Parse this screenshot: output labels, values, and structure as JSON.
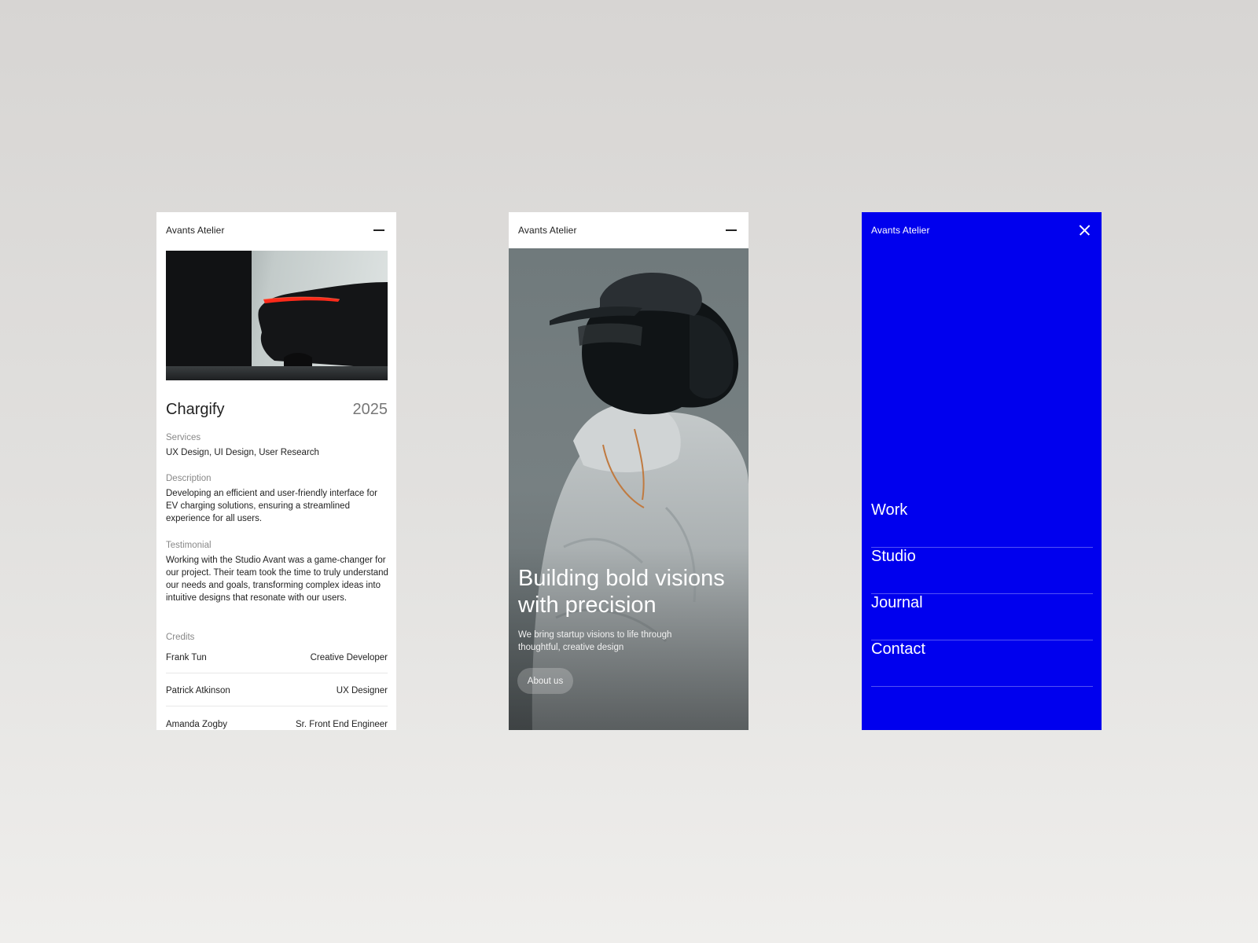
{
  "brand": "Avants Atelier",
  "project_screen": {
    "title": "Chargify",
    "year": "2025",
    "services_label": "Services",
    "services": "UX Design, UI Design, User Research",
    "description_label": "Description",
    "description": "Developing an efficient and user-friendly interface for EV charging solutions, ensuring a streamlined experience for all users.",
    "testimonial_label": "Testimonial",
    "testimonial": "Working with the Studio Avant was a game-changer for our project. Their team took the time to truly understand our needs and goals, transforming complex ideas into intuitive designs that resonate with our users.",
    "credits_label": "Credits",
    "credits": [
      {
        "name": "Frank Tun",
        "role": "Creative Developer"
      },
      {
        "name": "Patrick Atkinson",
        "role": "UX Designer"
      },
      {
        "name": "Amanda Zogby",
        "role": "Sr. Front End Engineer"
      }
    ]
  },
  "hero_screen": {
    "headline": "Building bold visions with precision",
    "subtext": "We bring startup visions to life through thoughtful, creative design",
    "cta": "About us"
  },
  "menu_screen": {
    "items": [
      "Work",
      "Studio",
      "Journal",
      "Contact"
    ]
  },
  "colors": {
    "menu_background": "#0000ee",
    "accent_red": "#ff2a1a"
  },
  "icons": [
    "menu-dash-icon",
    "close-icon"
  ]
}
